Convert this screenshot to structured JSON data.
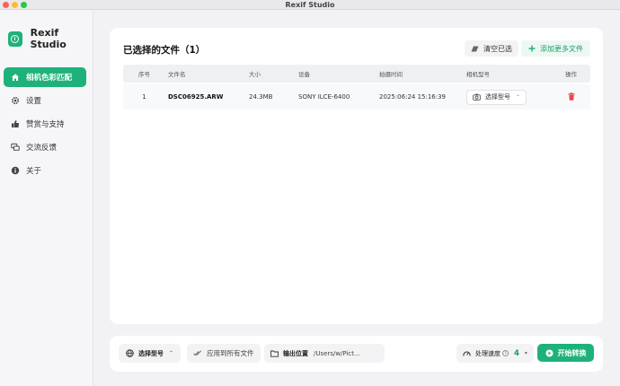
{
  "window": {
    "title": "Rexif Studio"
  },
  "brand": {
    "name": "Rexif Studio"
  },
  "sidebar": {
    "items": [
      {
        "label": "相机色彩匹配",
        "icon": "home-icon",
        "active": true
      },
      {
        "label": "设置",
        "icon": "gear-icon",
        "active": false
      },
      {
        "label": "赞赏与支持",
        "icon": "thumbs-up-icon",
        "active": false
      },
      {
        "label": "交流反馈",
        "icon": "chat-icon",
        "active": false
      },
      {
        "label": "关于",
        "icon": "info-icon",
        "active": false
      }
    ]
  },
  "main": {
    "title": "已选择的文件（1）",
    "clear_label": "清空已选",
    "add_label": "添加更多文件",
    "columns": [
      "序号",
      "文件名",
      "大小",
      "设备",
      "拍摄时间",
      "相机型号",
      "操作"
    ],
    "rows": [
      {
        "index": "1",
        "filename": "DSC06925.ARW",
        "size": "24.3MB",
        "device": "SONY ILCE-6400",
        "time": "2025:06:24 15:16:39",
        "model_select": "选择型号"
      }
    ]
  },
  "bottom": {
    "select_label": "选择型号",
    "apply_label": "应用到所有文件",
    "output_label": "输出位置",
    "output_path": "/Users/w/Pict...",
    "speed_label": "处理速度",
    "speed_value": "4",
    "start_label": "开始转换"
  },
  "colors": {
    "accent": "#1eb27a",
    "delete": "#e5484d"
  }
}
